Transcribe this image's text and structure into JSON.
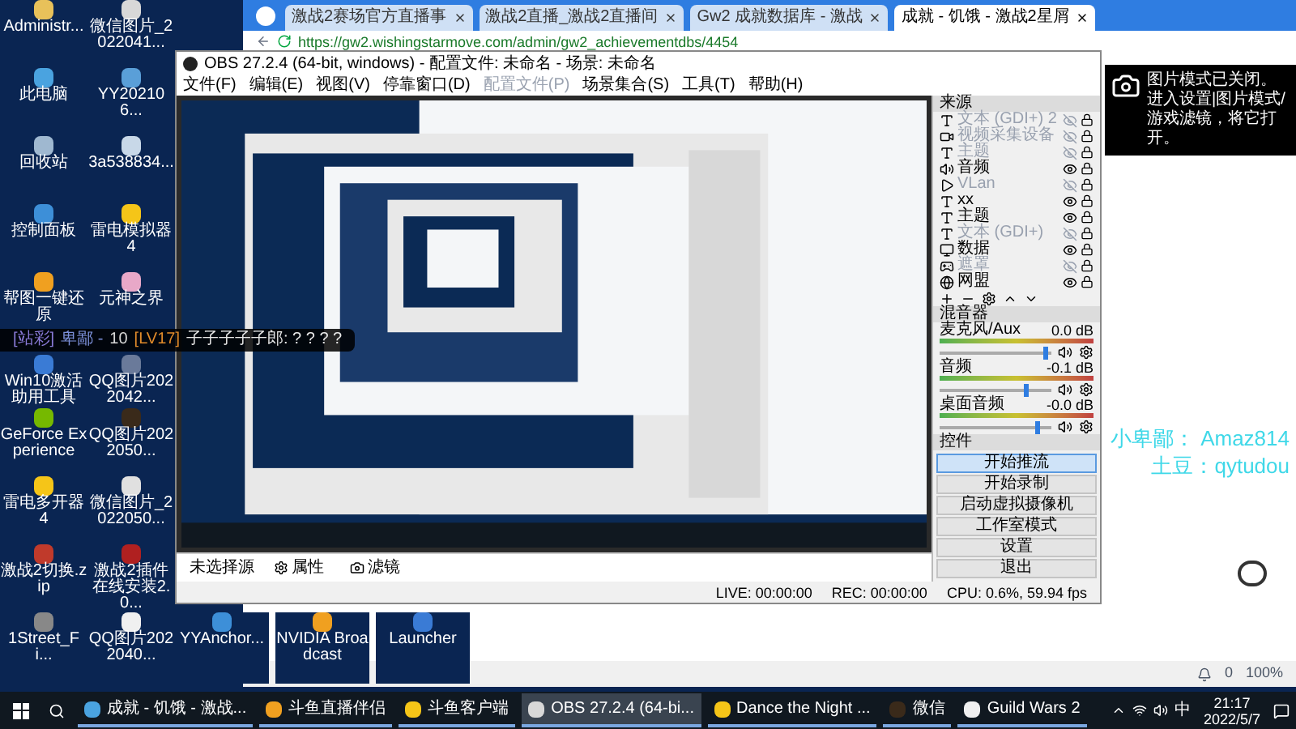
{
  "desktop_icons": [
    {
      "label": "Administr..."
    },
    {
      "label": "此电脑"
    },
    {
      "label": "回收站"
    },
    {
      "label": "控制面板"
    },
    {
      "label": "帮图一键还原"
    },
    {
      "label": "Win10激活助用工具"
    },
    {
      "label": "GeForce Experience"
    },
    {
      "label": "雷电多开器4"
    },
    {
      "label": "激战2切换.zip"
    },
    {
      "label": "1Street_Fi..."
    },
    {
      "label": "微信图片_2022041..."
    },
    {
      "label": "YY202106..."
    },
    {
      "label": "3a538834..."
    },
    {
      "label": "雷电模拟器4"
    },
    {
      "label": "元神之界"
    },
    {
      "label": "QQ图片2022042..."
    },
    {
      "label": "QQ图片2022050..."
    },
    {
      "label": "微信图片_2022050..."
    },
    {
      "label": "激战2插件在线安装2.0..."
    },
    {
      "label": "QQ图片2022040..."
    }
  ],
  "desktop_icons_extra": [
    {
      "label": "YYAnchor..."
    },
    {
      "label": "NVIDIA Broadcast"
    },
    {
      "label": "Launcher"
    }
  ],
  "chat_overlay": {
    "parts": [
      {
        "text": "[站彩]",
        "color": "#8a7bd8"
      },
      {
        "text": "卑鄙 -",
        "color": "#7b8fd8"
      },
      {
        "text": "10",
        "color": "#d8d8d8"
      },
      {
        "text": "[LV17]",
        "color": "#e08a2a"
      },
      {
        "text": "子子子子子郎: ? ? ? ?",
        "color": "#e8e8e8"
      }
    ]
  },
  "browser": {
    "tabs": [
      {
        "title": "激战2赛场官方直播事",
        "selected": false
      },
      {
        "title": "激战2直播_激战2直播间",
        "selected": false
      },
      {
        "title": "Gw2 成就数据库 - 激战",
        "selected": false
      },
      {
        "title": "成就 - 饥饿 - 激战2星屑",
        "selected": true
      }
    ],
    "url": "https://gw2.wishingstarmove.com/admin/gw2_achievementdbs/4454",
    "status": {
      "count": "0",
      "zoom": "100%"
    }
  },
  "obs": {
    "title": "OBS 27.2.4 (64-bit, windows) - 配置文件: 未命名 - 场景: 未命名",
    "menu": [
      {
        "label": "文件(F)",
        "disabled": false
      },
      {
        "label": "编辑(E)",
        "disabled": false
      },
      {
        "label": "视图(V)",
        "disabled": false
      },
      {
        "label": "停靠窗口(D)",
        "disabled": false
      },
      {
        "label": "配置文件(P)",
        "disabled": true
      },
      {
        "label": "场景集合(S)",
        "disabled": false
      },
      {
        "label": "工具(T)",
        "disabled": false
      },
      {
        "label": "帮助(H)",
        "disabled": false
      }
    ],
    "sources": {
      "title": "来源",
      "items": [
        {
          "name": "文本 (GDI+) 2",
          "kind": "text",
          "visible": false
        },
        {
          "name": "视频采集设备",
          "kind": "video",
          "visible": false
        },
        {
          "name": "主题",
          "kind": "text",
          "visible": false
        },
        {
          "name": "音频",
          "kind": "audio",
          "visible": true
        },
        {
          "name": "VLan",
          "kind": "media",
          "visible": false
        },
        {
          "name": "xx",
          "kind": "text",
          "visible": true
        },
        {
          "name": "主题",
          "kind": "text",
          "visible": true
        },
        {
          "name": "文本 (GDI+)",
          "kind": "text",
          "visible": false
        },
        {
          "name": "数据",
          "kind": "window",
          "visible": true
        },
        {
          "name": "遮罩",
          "kind": "game",
          "visible": false
        },
        {
          "name": "网盟",
          "kind": "browser",
          "visible": true
        }
      ]
    },
    "mixer": {
      "title": "混音器",
      "channels": [
        {
          "name": "麦克风/Aux",
          "reading": "0.0 dB",
          "level": 0.97
        },
        {
          "name": "音频",
          "reading": "-0.1 dB",
          "level": 0.8
        },
        {
          "name": "桌面音频",
          "reading": "-0.0 dB",
          "level": 0.9
        }
      ]
    },
    "controls": {
      "title": "控件",
      "buttons": [
        {
          "label": "开始推流",
          "selected": true
        },
        {
          "label": "开始录制",
          "selected": false
        },
        {
          "label": "启动虚拟摄像机",
          "selected": false
        },
        {
          "label": "工作室模式",
          "selected": false
        },
        {
          "label": "设置",
          "selected": false
        },
        {
          "label": "退出",
          "selected": false
        }
      ]
    },
    "source_bar": {
      "label": "未选择源",
      "buttons": [
        "属性",
        "滤镜"
      ]
    },
    "status": {
      "live": "LIVE: 00:00:00",
      "rec": "REC: 00:00:00",
      "cpu": "CPU: 0.6%, 59.94 fps"
    }
  },
  "toast": {
    "message": "图片模式已关闭。进入设置|图片模式/游戏滤镜，将它打开。"
  },
  "stream_overlay": {
    "lines": [
      "小卑鄙： Amaz814",
      "土豆：qytudou"
    ]
  },
  "taskbar": {
    "items": [
      {
        "label": "成就 - 饥饿 - 激战...",
        "selected": false
      },
      {
        "label": "斗鱼直播伴侣",
        "selected": false
      },
      {
        "label": "斗鱼客户端",
        "selected": false
      },
      {
        "label": "OBS 27.2.4 (64-bi...",
        "selected": true
      },
      {
        "label": "Dance the Night ...",
        "selected": false
      },
      {
        "label": "微信",
        "selected": false
      },
      {
        "label": "Guild Wars 2",
        "selected": false
      }
    ],
    "ime": "中",
    "time": "21:17",
    "date": "2022/5/7"
  }
}
